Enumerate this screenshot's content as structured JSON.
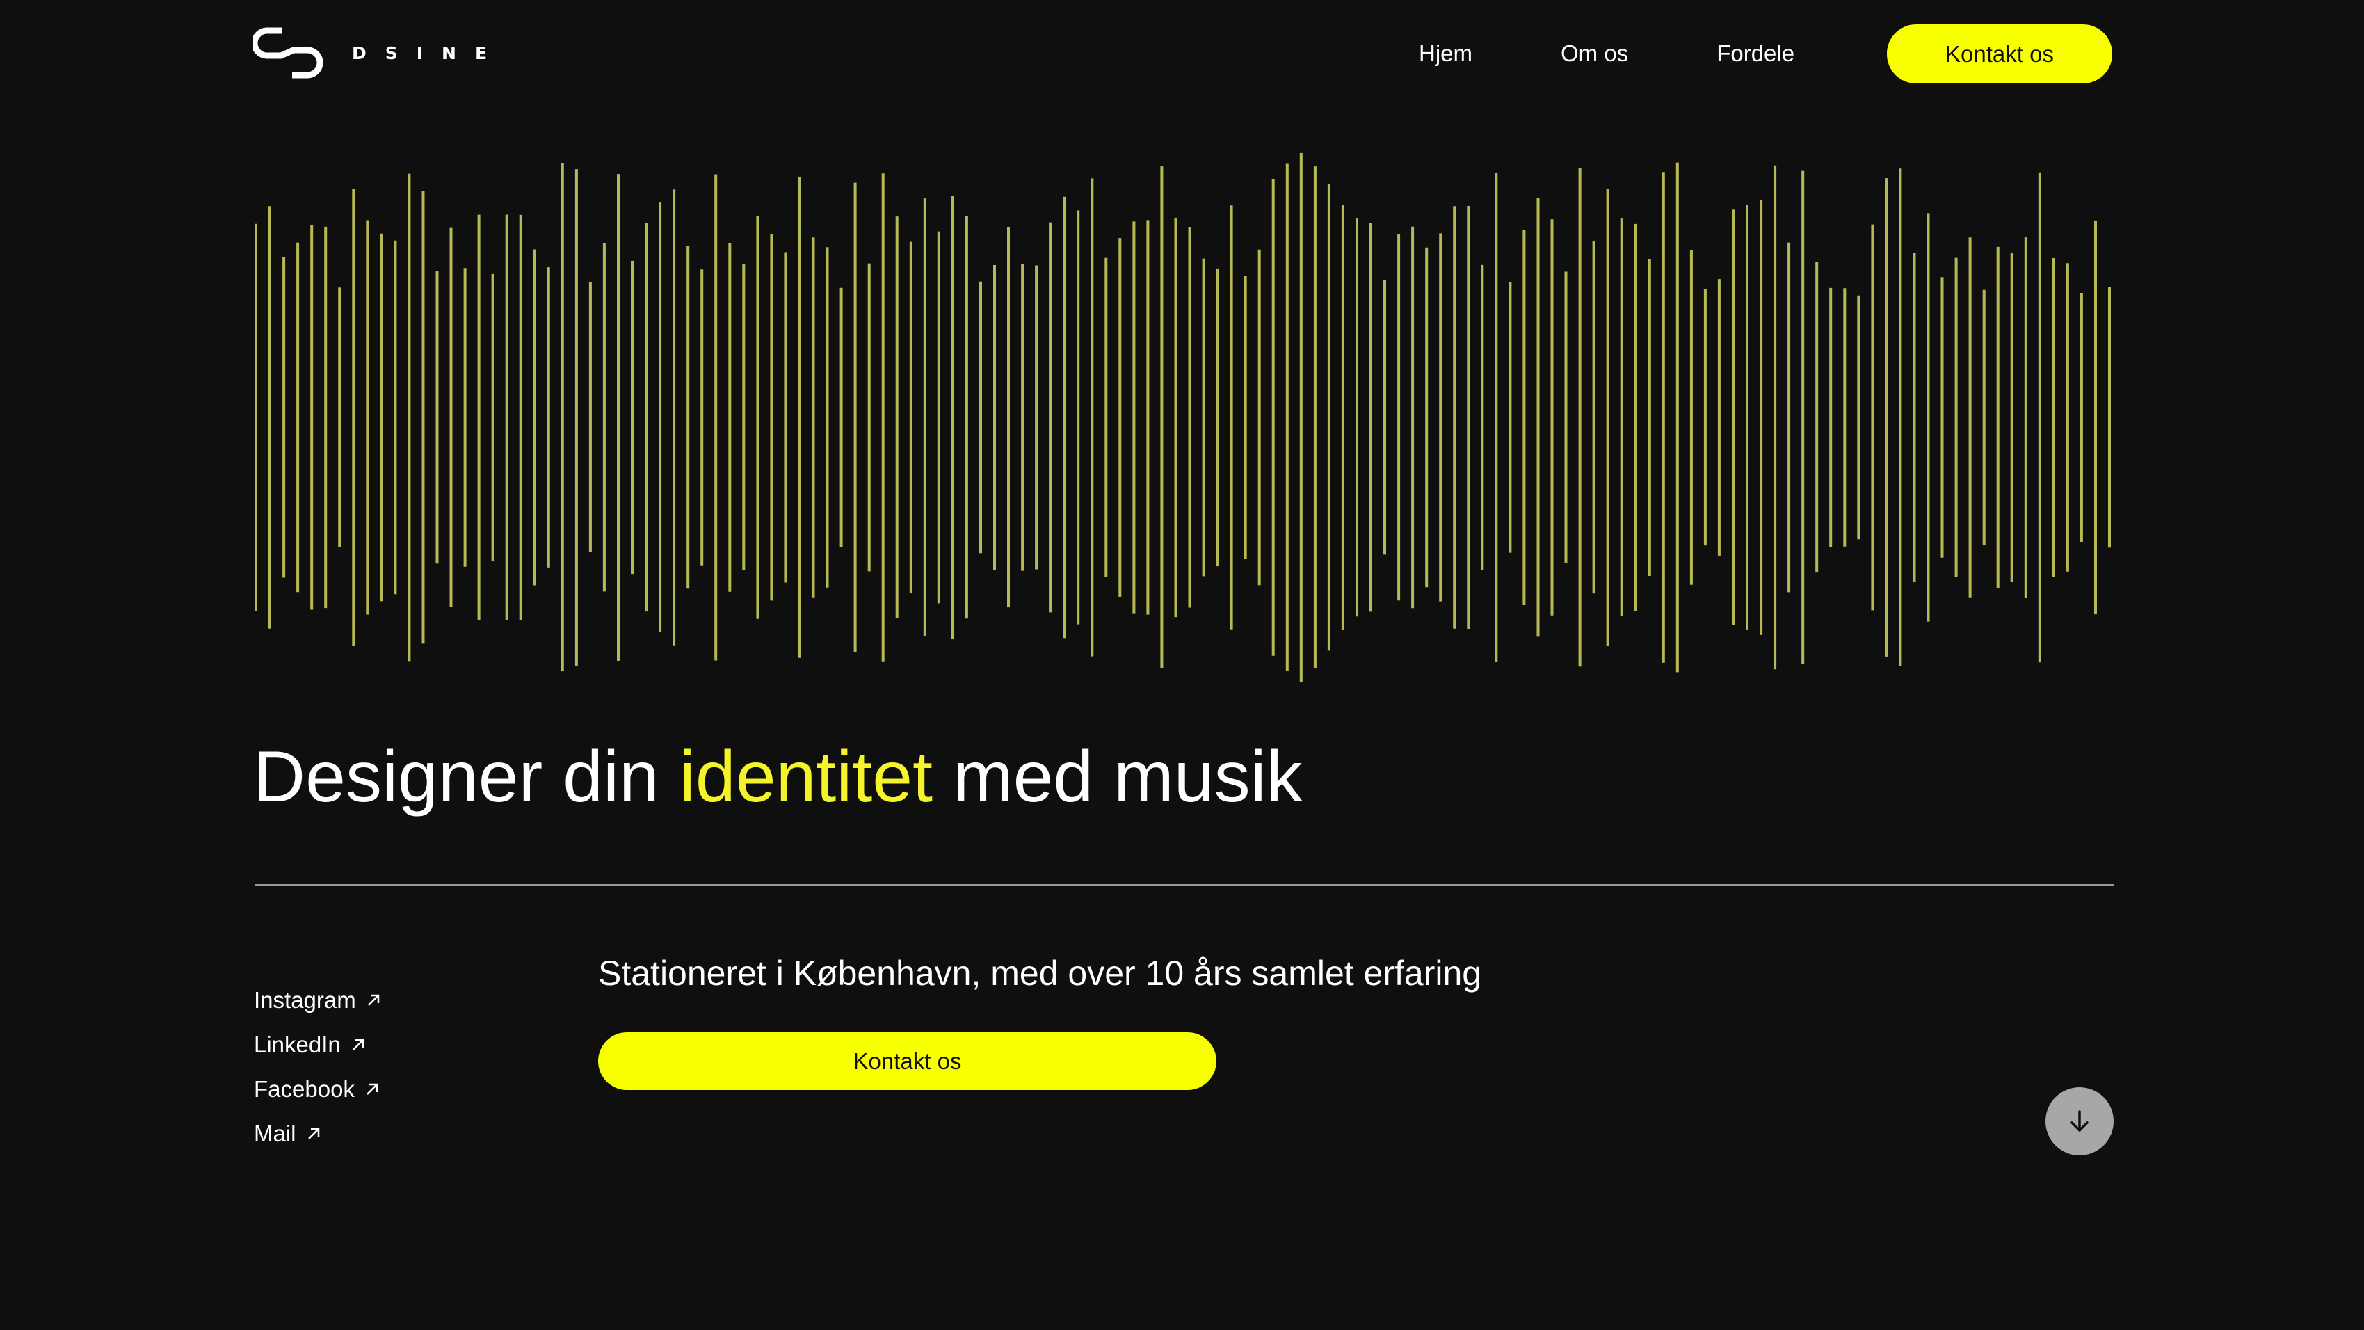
{
  "brand": {
    "name": "DSINE",
    "accent_color": "#f8ff00",
    "background_color": "#0f0f0f"
  },
  "nav": {
    "items": [
      {
        "label": "Hjem"
      },
      {
        "label": "Om os"
      },
      {
        "label": "Fordele"
      }
    ],
    "cta_label": "Kontakt os"
  },
  "hero": {
    "headline_part1": "Designer din ",
    "headline_accent": "identitet",
    "headline_part2": " med musik",
    "tagline": "Stationeret i København, med over 10 års samlet erfaring",
    "cta_label": "Kontakt os"
  },
  "social": {
    "links": [
      {
        "label": "Instagram",
        "icon": "arrow-up-right-icon"
      },
      {
        "label": "LinkedIn",
        "icon": "arrow-up-right-icon"
      },
      {
        "label": "Facebook",
        "icon": "arrow-up-right-icon"
      },
      {
        "label": "Mail",
        "icon": "arrow-up-right-icon"
      }
    ]
  },
  "scroll_button": {
    "icon": "arrow-down-icon"
  },
  "waveform": {
    "icon": "audio-waveform",
    "color": "#b7ba52",
    "bar_count": 134
  }
}
